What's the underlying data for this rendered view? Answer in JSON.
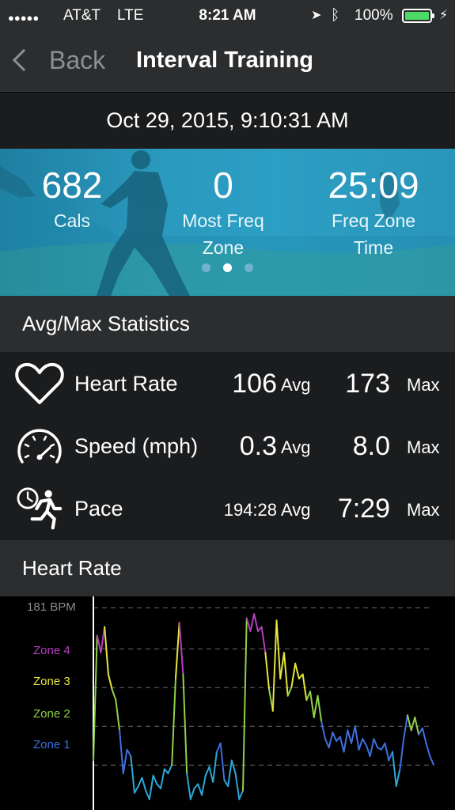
{
  "status_bar": {
    "signal": "●●●●●",
    "carrier": "AT&T",
    "network": "LTE",
    "time": "8:21 AM",
    "battery_pct": "100%"
  },
  "nav": {
    "back_label": "Back",
    "title": "Interval Training"
  },
  "session_date": "Oct 29, 2015, 9:10:31 AM",
  "summary": {
    "calories": {
      "value": "682",
      "label": "Cals"
    },
    "most_freq_zone": {
      "value": "0",
      "label_line1": "Most Freq",
      "label_line2": "Zone"
    },
    "freq_zone_time": {
      "value": "25:09",
      "label_line1": "Freq Zone",
      "label_line2": "Time"
    },
    "page_count": 3,
    "active_page": 1
  },
  "avg_max": {
    "header": "Avg/Max Statistics",
    "rows": [
      {
        "icon": "heart-icon",
        "name": "Heart Rate",
        "avg": "106",
        "avg_label": "Avg",
        "max": "173",
        "max_label": "Max"
      },
      {
        "icon": "speedometer-icon",
        "name": "Speed (mph)",
        "avg": "0.3",
        "avg_label": "Avg",
        "max": "8.0",
        "max_label": "Max"
      },
      {
        "icon": "pace-runner-icon",
        "name": "Pace",
        "avg": "194:28",
        "avg_label": "Avg",
        "max": "7:29",
        "max_label": "Max"
      }
    ]
  },
  "heart_rate": {
    "header": "Heart Rate"
  },
  "chart_data": {
    "type": "line",
    "title": "",
    "ylabel_top": "181 BPM",
    "zones": [
      {
        "name": "Zone 4",
        "color": "#b63fbf"
      },
      {
        "name": "Zone 3",
        "color": "#e6e63a"
      },
      {
        "name": "Zone 2",
        "color": "#8fd14a"
      },
      {
        "name": "Zone 1",
        "color": "#3f6fe0"
      }
    ],
    "below_zone_color": "#2aa8d8",
    "ymax": 181,
    "ymin": 87,
    "zone_thresholds": [
      162,
      144,
      126,
      108
    ],
    "values": [
      110,
      168,
      160,
      172,
      150,
      143,
      138,
      124,
      104,
      115,
      112,
      95,
      98,
      102,
      96,
      92,
      103,
      99,
      97,
      106,
      104,
      108,
      148,
      174,
      150,
      104,
      92,
      97,
      99,
      94,
      103,
      107,
      100,
      114,
      118,
      101,
      98,
      110,
      104,
      92,
      96,
      176,
      170,
      178,
      170,
      172,
      160,
      143,
      133,
      175,
      148,
      160,
      140,
      144,
      155,
      148,
      150,
      138,
      142,
      130,
      140,
      128,
      120,
      116,
      123,
      119,
      121,
      114,
      124,
      118,
      126,
      115,
      120,
      117,
      112,
      120,
      116,
      115,
      118,
      110,
      114,
      98,
      106,
      120,
      131,
      124,
      130,
      122,
      125,
      118,
      112,
      108
    ]
  }
}
